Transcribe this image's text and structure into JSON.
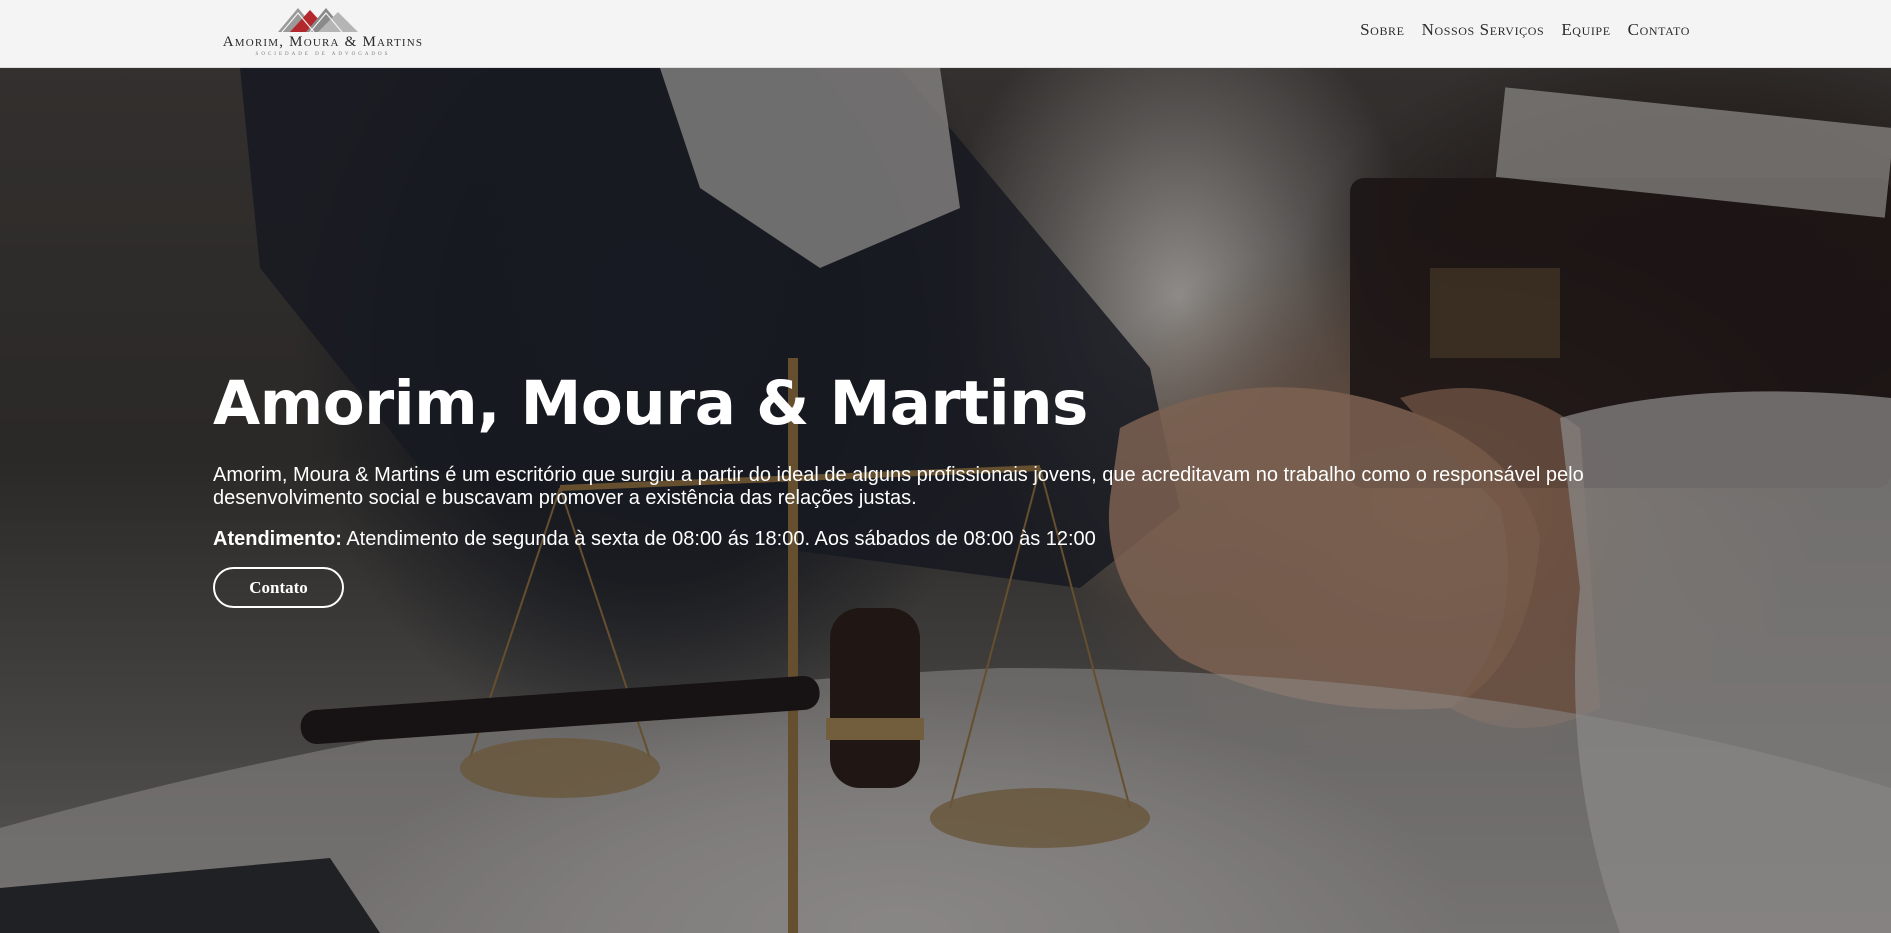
{
  "header": {
    "logo": {
      "name": "Amorim, Moura & Martins",
      "subtitle": "Sociedade de Advogados"
    },
    "nav": [
      "Sobre",
      "Nossos Serviços",
      "Equipe",
      "Contato"
    ]
  },
  "hero": {
    "title": "Amorim, Moura & Martins",
    "description": "Amorim, Moura & Martins é um escritório que surgiu a partir do ideal de alguns profissionais jovens, que acreditavam no trabalho como o responsável pelo desenvolvimento social e buscavam promover a existência das relações justas.",
    "hours_label": "Atendimento:",
    "hours_text": " Atendimento de segunda à sexta de 08:00 ás 18:00. Aos sábados de 08:00 às 12:00",
    "cta_label": "Contato",
    "background": "handshake-scales-gavel-photo"
  },
  "colors": {
    "header_bg": "#f4f4f4",
    "logo_accent": "#b3272d",
    "text_light": "#ffffff"
  }
}
